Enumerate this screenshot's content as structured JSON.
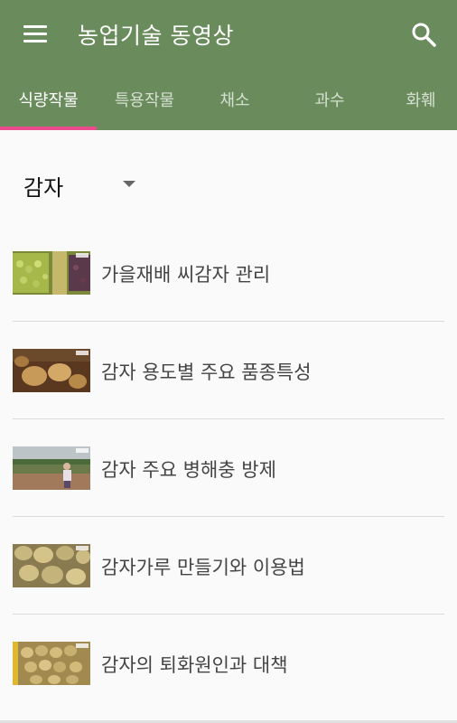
{
  "appbar": {
    "title": "농업기술 동영상",
    "bg_color": "#6a8c5c"
  },
  "icons": {
    "menu": "hamburger-menu-icon",
    "search": "search-icon"
  },
  "tabs": [
    {
      "label": "식량작물",
      "active": true
    },
    {
      "label": "특용작물",
      "active": false
    },
    {
      "label": "채소",
      "active": false
    },
    {
      "label": "과수",
      "active": false
    },
    {
      "label": "화훼",
      "active": false
    }
  ],
  "accent_color": "#ec4b8d",
  "filter": {
    "selected": "감자"
  },
  "videos": [
    {
      "title": "가을재배 씨감자 관리"
    },
    {
      "title": "감자 용도별 주요 품종특성"
    },
    {
      "title": "감자 주요 병해충 방제"
    },
    {
      "title": "감자가루 만들기와 이용법"
    },
    {
      "title": "감자의 퇴화원인과 대책"
    }
  ]
}
